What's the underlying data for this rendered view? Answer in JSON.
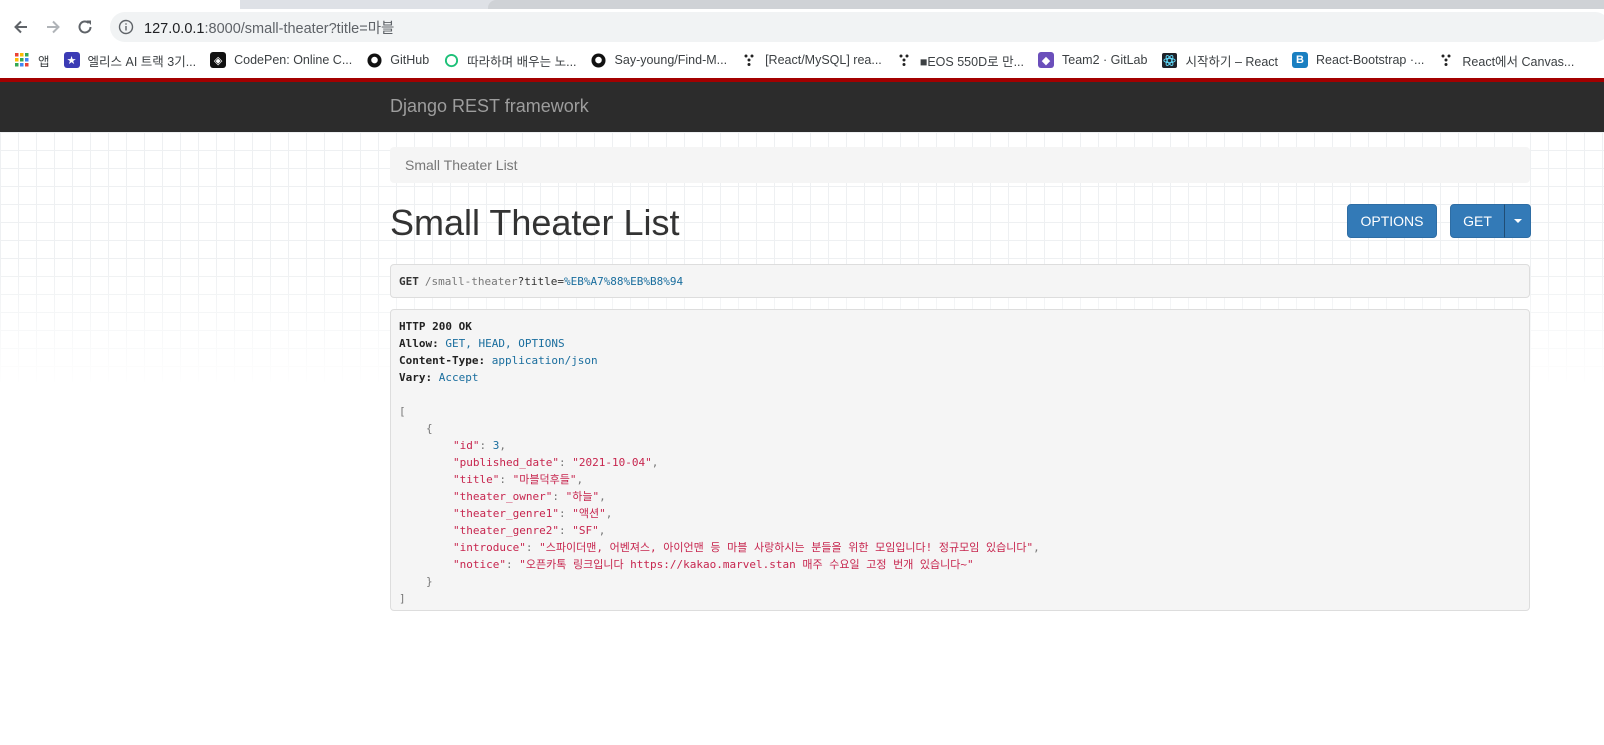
{
  "browser": {
    "url_host": "127.0.0.1",
    "url_rest": ":8000/small-theater?title=마블",
    "bookmarks": [
      {
        "label": "앱",
        "icon": "apps-grid-icon"
      },
      {
        "label": "엘리스 AI 트랙 3기...",
        "icon": "elice-icon"
      },
      {
        "label": "CodePen: Online C...",
        "icon": "codepen-icon"
      },
      {
        "label": "GitHub",
        "icon": "github-icon"
      },
      {
        "label": "따라하며 배우는 노...",
        "icon": "inflearn-icon"
      },
      {
        "label": "Say-young/Find-M...",
        "icon": "github-icon"
      },
      {
        "label": "[React/MySQL] rea...",
        "icon": "velog-icon"
      },
      {
        "label": "■EOS 550D로 만...",
        "icon": "velog-icon"
      },
      {
        "label": "Team2 · GitLab",
        "icon": "gitlab-icon"
      },
      {
        "label": "시작하기 – React",
        "icon": "react-icon"
      },
      {
        "label": "React-Bootstrap ·...",
        "icon": "react-bootstrap-icon"
      },
      {
        "label": "React에서 Canvas...",
        "icon": "velog-icon"
      }
    ]
  },
  "navbar": {
    "brand": "Django REST framework"
  },
  "breadcrumb": {
    "current": "Small Theater List"
  },
  "page": {
    "title": "Small Theater List",
    "options_label": "OPTIONS",
    "get_label": "GET"
  },
  "request": {
    "method": "GET",
    "path": "/small-theater",
    "query_key": "?title=",
    "query_value": "%EB%A7%88%EB%B8%94"
  },
  "response": {
    "status": "HTTP 200 OK",
    "headers": [
      {
        "key": "Allow:",
        "value": "GET, HEAD, OPTIONS"
      },
      {
        "key": "Content-Type:",
        "value": "application/json"
      },
      {
        "key": "Vary:",
        "value": "Accept"
      }
    ],
    "open_bracket": "[",
    "open_brace": "{",
    "fields": [
      {
        "key": "\"id\"",
        "value": "3",
        "type": "num"
      },
      {
        "key": "\"published_date\"",
        "value": "\"2021-10-04\"",
        "type": "str"
      },
      {
        "key": "\"title\"",
        "value": "\"마블덕후들\"",
        "type": "str"
      },
      {
        "key": "\"theater_owner\"",
        "value": "\"하늘\"",
        "type": "str"
      },
      {
        "key": "\"theater_genre1\"",
        "value": "\"액션\"",
        "type": "str"
      },
      {
        "key": "\"theater_genre2\"",
        "value": "\"SF\"",
        "type": "str"
      },
      {
        "key": "\"introduce\"",
        "value": "\"스파이더맨, 어벤져스, 아이언맨 등 마블 사랑하시는 분들을 위한 모임입니다! 정규모임 있습니다\"",
        "type": "str"
      },
      {
        "key": "\"notice\"",
        "value": "\"오픈카톡 링크입니다 https://kakao.marvel.stan 매주 수요일 고정 번개 있습니다~\"",
        "type": "str"
      }
    ],
    "close_brace": "}",
    "close_bracket": "]"
  }
}
